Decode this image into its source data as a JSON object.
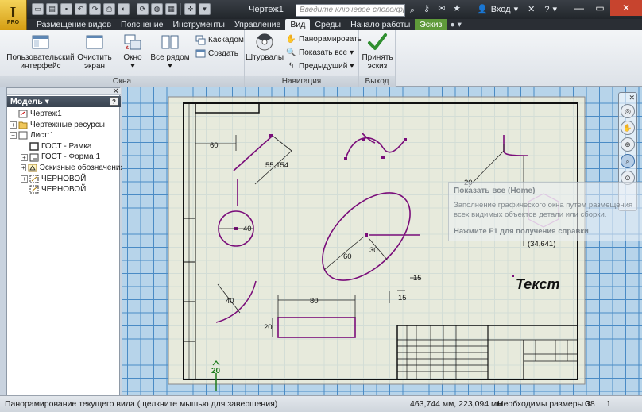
{
  "app": {
    "logo_glyph": "I",
    "logo_badge": "PRO"
  },
  "window": {
    "title": "Чертеж1"
  },
  "search": {
    "placeholder": "Введите ключевое слово/фразу"
  },
  "user": {
    "signin_label": "Вход"
  },
  "tabs": [
    {
      "label": "Размещение видов"
    },
    {
      "label": "Пояснение"
    },
    {
      "label": "Инструменты"
    },
    {
      "label": "Управление"
    },
    {
      "label": "Вид"
    },
    {
      "label": "Среды"
    },
    {
      "label": "Начало работы"
    },
    {
      "label": "Эскиз"
    }
  ],
  "ribbon": {
    "user_interface": {
      "line1": "Пользовательский",
      "line2": "интерфейс"
    },
    "clear_screen": {
      "line1": "Очистить",
      "line2": "экран"
    },
    "window": {
      "label": "Окно"
    },
    "arrange_all": {
      "label": "Все рядом"
    },
    "cascade": {
      "label": "Каскадом"
    },
    "create": {
      "label": "Создать"
    },
    "steering_wheels": {
      "label": "Штурвалы"
    },
    "pan": {
      "label": "Панорамировать"
    },
    "zoom_all": {
      "label": "Показать все"
    },
    "previous": {
      "label": "Предыдущий"
    },
    "finish_sketch": {
      "line1": "Принять",
      "line2": "эскиз"
    },
    "groups": {
      "windows": "Окна",
      "navigation": "Навигация",
      "exit": "Выход"
    }
  },
  "browser": {
    "title": "Модель",
    "help": "?",
    "items": [
      {
        "label": "Чертеж1"
      },
      {
        "label": "Чертежные ресурсы"
      },
      {
        "label": "Лист:1"
      },
      {
        "label": "ГОСТ - Рамка"
      },
      {
        "label": "ГОСТ - Форма 1"
      },
      {
        "label": "Эскизные обозначения"
      },
      {
        "label": "ЧЕРНОВОЙ"
      },
      {
        "label": "ЧЕРНОВОЙ"
      }
    ]
  },
  "drawing": {
    "dims": {
      "d60_top": "60",
      "d55": "55,154",
      "d40_circle": "40",
      "d60_ellipse": "60",
      "d30": "30",
      "d80": "80",
      "d40_arc": "40",
      "d20_rect": "20",
      "d15_a": "15",
      "d15_b": "15",
      "d20_diag": "20",
      "d34": "(34,641)",
      "d20_bottom": "20"
    },
    "text_note": "Текст"
  },
  "tooltip": {
    "title": "Показать все (Home)",
    "body": "Заполнение графического окна путем размещения всех видимых объектов детали или сборки.",
    "help": "Нажмите F1 для получения справки"
  },
  "status": {
    "message": "Панорамирование текущего вида (щелкните мышью для завершения)",
    "coords": "463,744 мм, 223,094 мм",
    "dims_needed": "Необходимы размеры 38",
    "count1": "0",
    "count2": "1"
  },
  "colors": {
    "sketch_purple": "#7a0d7a",
    "sheet_fill": "#f2efd9",
    "grid_line": "#4a8bc5",
    "canvas_bg": "#b7d4ea",
    "sketch_tab": "#5f9a3a",
    "finish_check": "#2f8f2f"
  }
}
